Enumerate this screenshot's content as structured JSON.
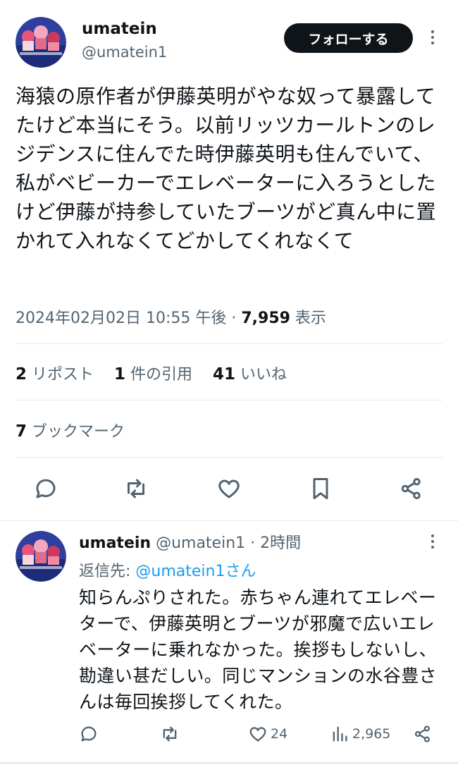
{
  "main_tweet": {
    "display_name": "umatein",
    "handle": "@umatein1",
    "follow_label": "フォローする",
    "text": "海猿の原作者が伊藤英明がやな奴って暴露してたけど本当にそう。以前リッツカールトンのレジデンスに住んでた時伊藤英明も住んでいて、私がベビーカーでエレベーターに入ろうとしたけど伊藤が持参していたブーツがど真ん中に置かれて入れなくてどかしてくれなくて",
    "timestamp": "2024年02月02日 10:55 午後 · ",
    "views_count": "7,959",
    "views_label": " 表示",
    "reposts_count": "2",
    "reposts_label": " リポスト",
    "quotes_count": "1",
    "quotes_label": " 件の引用",
    "likes_count": "41",
    "likes_label": " いいね",
    "bookmarks_count": "7",
    "bookmarks_label": " ブックマーク",
    "actions": [
      "reply-icon",
      "repost-icon",
      "like-icon",
      "bookmark-icon",
      "share-icon"
    ]
  },
  "reply": {
    "display_name": "umatein",
    "handle_time": " @umatein1 · 2時間",
    "reply_to_prefix": "返信先: ",
    "reply_to_handle": "@umatein1さん",
    "text": "知らんぷりされた。赤ちゃん連れてエレベーターで、伊藤英明とブーツが邪魔で広いエレベーターに乗れなかった。挨拶もしないし、勘違い甚だしい。同じマンションの水谷豊さんは毎回挨拶してくれた。",
    "likes": "24",
    "views": "2,965"
  },
  "colors": {
    "text": "#0f1419",
    "secondary": "#536471",
    "link": "#1d9bf0",
    "follow_bg": "#0f1419"
  }
}
